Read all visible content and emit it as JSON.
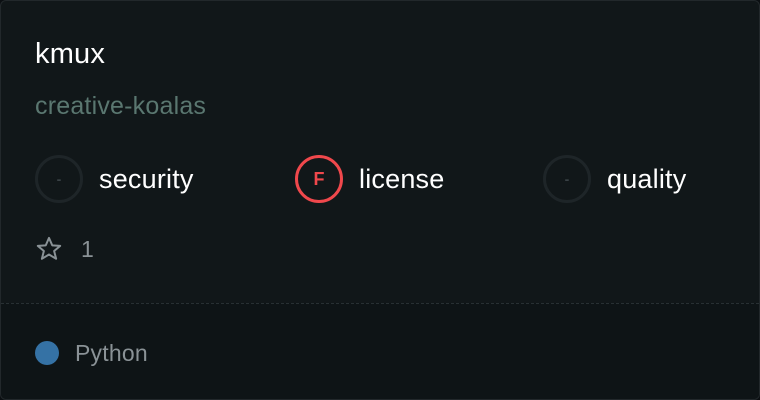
{
  "repo": {
    "name": "kmux",
    "owner": "creative-koalas"
  },
  "metrics": [
    {
      "grade": "-",
      "label": "security",
      "status": "none"
    },
    {
      "grade": "F",
      "label": "license",
      "status": "fail"
    },
    {
      "grade": "-",
      "label": "quality",
      "status": "none"
    }
  ],
  "stars": {
    "icon": "star-icon",
    "count": "1"
  },
  "language": {
    "name": "Python",
    "color": "#3572a5"
  },
  "colors": {
    "fail": "#f0484c",
    "owner_text": "#5a7770"
  }
}
